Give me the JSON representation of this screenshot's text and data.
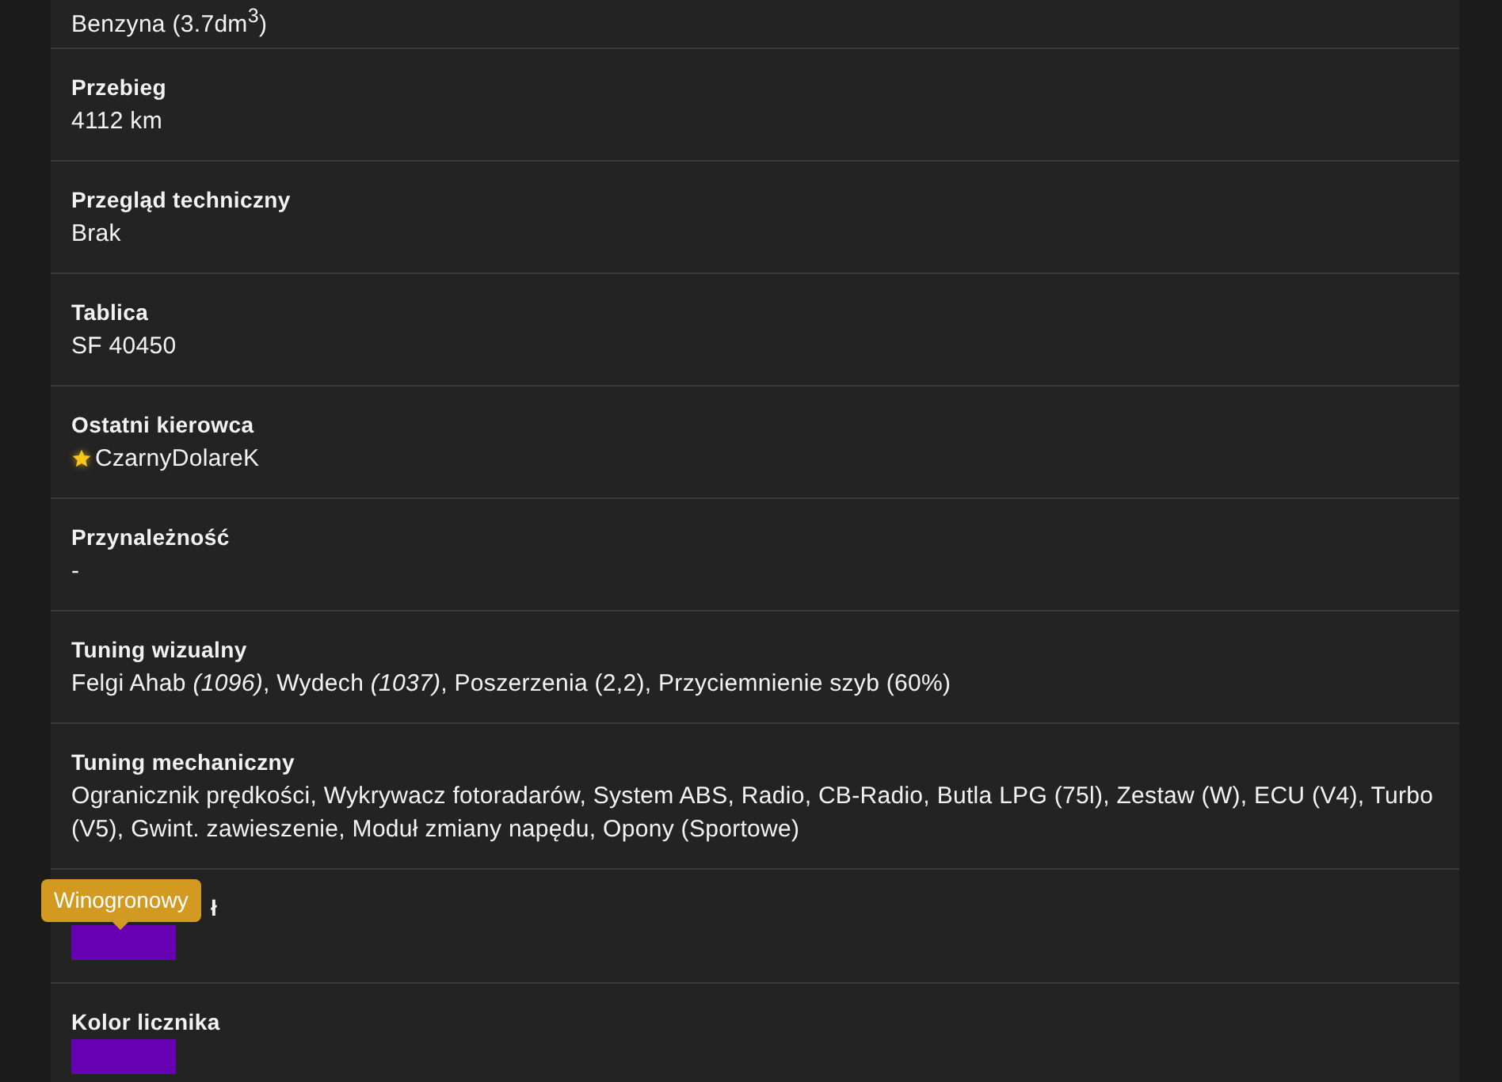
{
  "rows": [
    {
      "kind": "text",
      "value": "Benzyna (3.7dm$^{3}$)"
    },
    {
      "kind": "text",
      "label": "Przebieg",
      "value": "4112 km"
    },
    {
      "kind": "text",
      "label": "Przegląd techniczny",
      "value": "Brak"
    },
    {
      "kind": "text",
      "label": "Tablica",
      "value": "SF 40450"
    },
    {
      "kind": "driver",
      "label": "Ostatni kierowca",
      "value": "CzarnyDolareK"
    },
    {
      "kind": "text",
      "label": "Przynależność",
      "value": "-"
    },
    {
      "kind": "text",
      "label": "Tuning wizualny",
      "value": "Felgi Ahab *(1096)*, Wydech *(1037)*, Poszerzenia (2,2), Przyciemnienie szyb (60%)"
    },
    {
      "kind": "text",
      "label": "Tuning mechaniczny",
      "value": "Ogranicznik prędkości, Wykrywacz fotoradarów, System ABS, Radio, CB-Radio, Butla LPG (75l), Zestaw (W), ECU (V4), Turbo (V5), Gwint. zawieszenie, Moduł zmiany napędu, Opony (Sportowe)"
    },
    {
      "kind": "color",
      "label": "ł",
      "color": "#6600b3",
      "tooltip": "Winogronowy"
    },
    {
      "kind": "color",
      "label": "Kolor licznika",
      "color": "#6600b3"
    }
  ]
}
